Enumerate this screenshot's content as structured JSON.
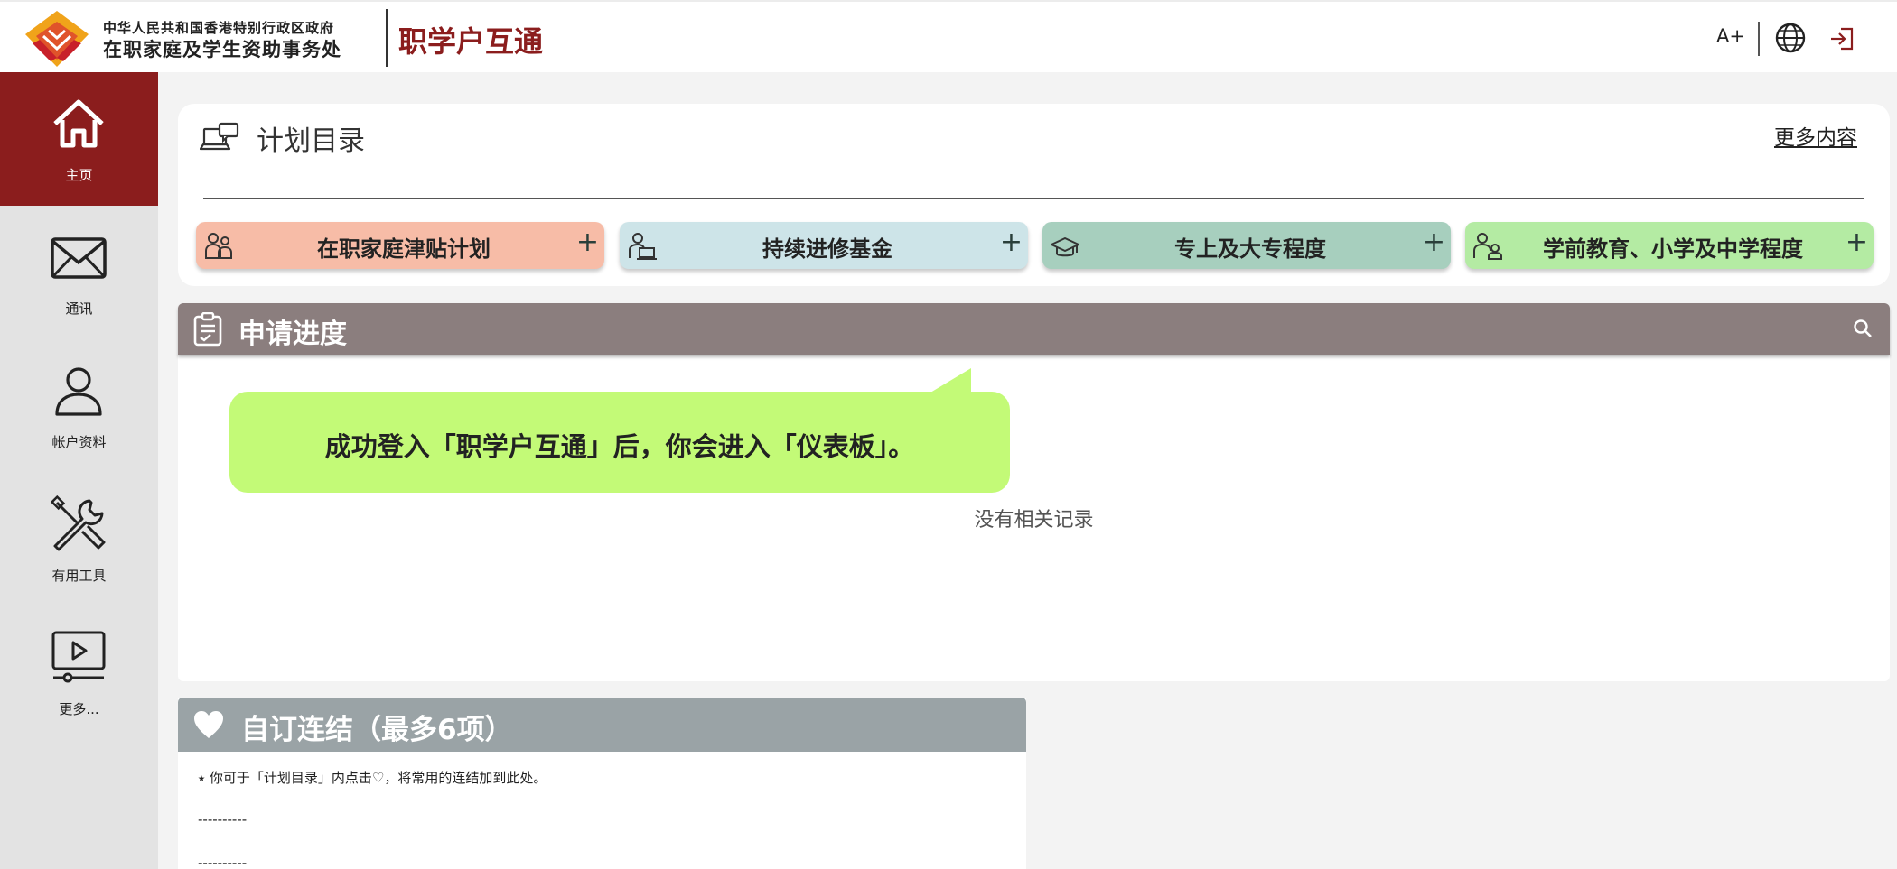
{
  "header": {
    "dept_line1": "中华人民共和国香港特别行政区政府",
    "dept_line2": "在职家庭及学生资助事务处",
    "brand": "职学户互通",
    "font_size_button": "A+",
    "accent_color": "#8b1d1d"
  },
  "sidebar": {
    "items": [
      {
        "label": "主页",
        "icon": "home-icon",
        "active": true
      },
      {
        "label": "通讯",
        "icon": "envelope-icon"
      },
      {
        "label": "帐户资料",
        "icon": "user-icon"
      },
      {
        "label": "有用工具",
        "icon": "tools-icon"
      },
      {
        "label": "更多...",
        "icon": "video-icon"
      }
    ]
  },
  "catalogue": {
    "title": "计划目录",
    "more_link": "更多内容",
    "programs": [
      {
        "label": "在职家庭津贴计划",
        "color": "#f7bca7",
        "icon": "family-icon"
      },
      {
        "label": "持续进修基金",
        "color": "#cde4e8",
        "icon": "study-icon"
      },
      {
        "label": "专上及大专程度",
        "color": "#a7cfbe",
        "icon": "graduation-cap-icon"
      },
      {
        "label": "学前教育、小学及中学程度",
        "color": "#b4eba3",
        "icon": "student-icon"
      }
    ]
  },
  "progress": {
    "title": "申请进度",
    "empty_message": "没有相关记录",
    "header_color": "#8b7e7e"
  },
  "tooltip": {
    "text": "成功登入「职学户互通」后，你会进入「仪表板」。",
    "color": "#c3fa77"
  },
  "custom_links": {
    "title": "自订连结（最多6项）",
    "note": "⭑ 你可于「计划目录」内点击♡，将常用的连结加到此处。",
    "slots": [
      "----------",
      "----------"
    ]
  }
}
